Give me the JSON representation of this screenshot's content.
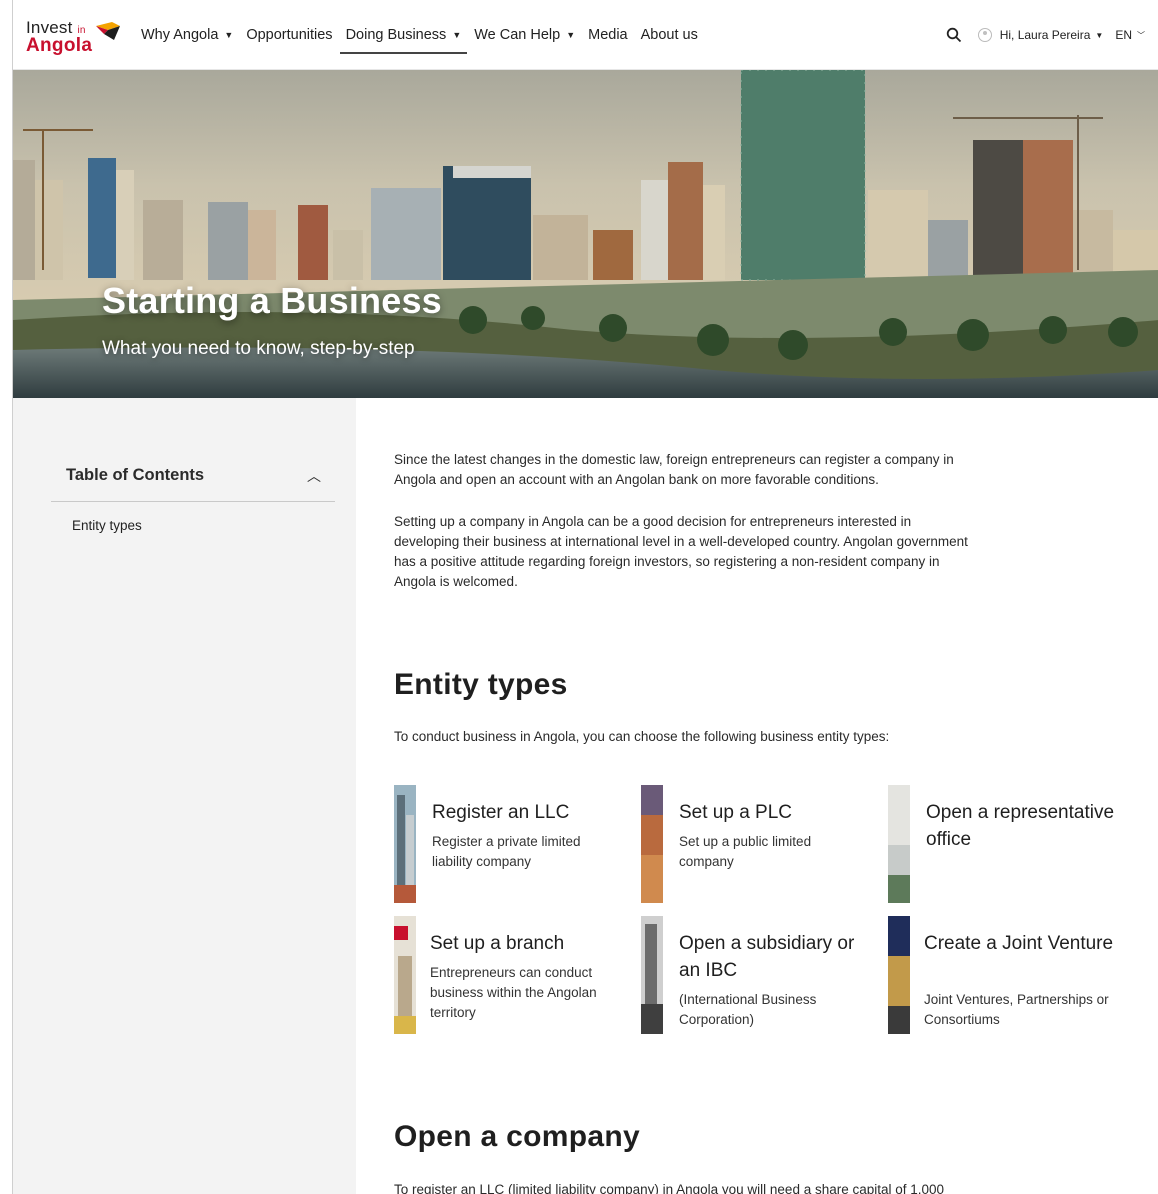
{
  "nav": {
    "logo_top": "Invest",
    "logo_in": "in",
    "logo_bottom": "Angola",
    "items": [
      {
        "label": "Why Angola",
        "dropdown": true
      },
      {
        "label": "Opportunities",
        "dropdown": false
      },
      {
        "label": "Doing Business",
        "dropdown": true,
        "active": true
      },
      {
        "label": "We Can Help",
        "dropdown": true
      },
      {
        "label": "Media",
        "dropdown": false
      },
      {
        "label": "About us",
        "dropdown": false
      }
    ],
    "user_greeting": "Hi, Laura Pereira",
    "language": "EN"
  },
  "hero": {
    "title": "Starting a Business",
    "subtitle": "What you need to know, step-by-step"
  },
  "sidebar": {
    "toc_title": "Table of Contents",
    "items": [
      "Entity types"
    ]
  },
  "main": {
    "intro_p1": "Since the latest changes in the domestic law, foreign entrepreneurs can register a company in Angola and open an account with an Angolan bank on more favorable conditions.",
    "intro_p2": "Setting up a company in Angola can be a good decision for entrepreneurs interested in developing their business at international level in a well-developed country. Angolan government has a positive attitude regarding foreign investors, so registering a non-resident company in Angola is welcomed.",
    "entity_heading": "Entity types",
    "entity_intro": "To conduct business in Angola, you can choose the following business entity types:",
    "cards": [
      {
        "title": "Register an LLC",
        "desc": "Register a private limited liability company"
      },
      {
        "title": "Set up a PLC",
        "desc": "Set up a public limited company"
      },
      {
        "title": "Open a representative office",
        "desc": ""
      },
      {
        "title": "Set up a branch",
        "desc": "Entrepreneurs can conduct business within the Angolan territory"
      },
      {
        "title": "Open a subsidiary or an IBC",
        "desc": "(International Business Corporation)"
      },
      {
        "title": "Create a Joint Venture",
        "desc": "Joint Ventures, Partnerships or Consortiums"
      }
    ],
    "company_heading": "Open a company",
    "company_p": "To register an LLC (limited liability company) in Angola you will need a share capital of 1,000"
  },
  "colors": {
    "brand_red": "#c8102e",
    "sidebar_bg": "#f3f3f3"
  }
}
